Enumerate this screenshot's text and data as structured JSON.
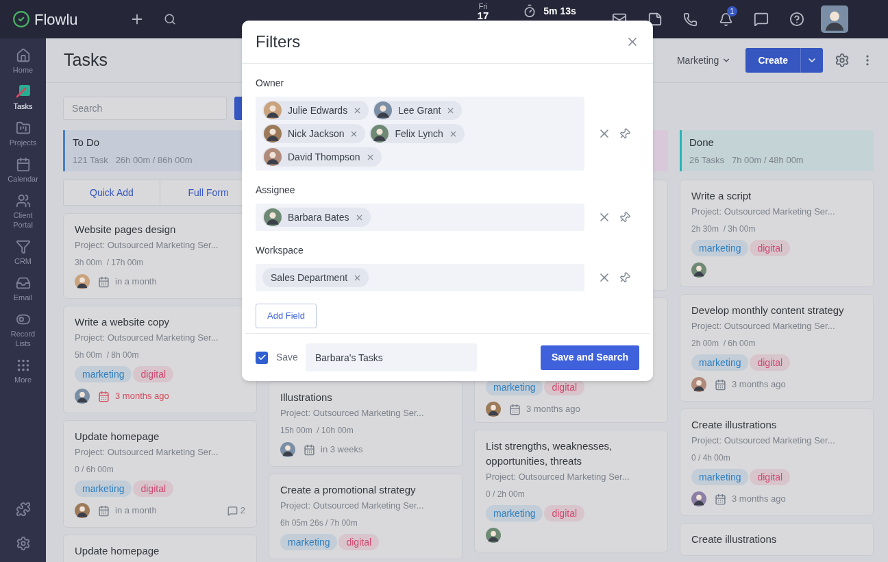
{
  "topbar": {
    "logo": "Flowlu",
    "day": "Fri",
    "date": "17",
    "timer": "5m 13s",
    "notifications": "1"
  },
  "sidebar": {
    "items": [
      {
        "label": "Home",
        "selected": false
      },
      {
        "label": "Tasks",
        "selected": true
      },
      {
        "label": "Projects",
        "selected": false
      },
      {
        "label": "Calendar",
        "selected": false
      },
      {
        "label": "Client Portal",
        "selected": false
      },
      {
        "label": "CRM",
        "selected": false
      },
      {
        "label": "Email",
        "selected": false
      },
      {
        "label": "Record Lists",
        "selected": false
      },
      {
        "label": "More",
        "selected": false
      }
    ]
  },
  "header": {
    "title": "Tasks",
    "workspace": "Marketing",
    "create": "Create"
  },
  "search": {
    "placeholder": "Search"
  },
  "columns": [
    {
      "title": "To Do",
      "count": "121 Task",
      "hours": "26h 00m / 86h 00m",
      "color": "#c5ccd8",
      "accent": {
        "color": "#4a7fc1"
      },
      "quick_add": "Quick Add",
      "full_form": "Full Form",
      "cards": [
        {
          "title": "Website pages design",
          "project": "Project: Outsourced Marketing Ser...",
          "time": "3h 00m  / 17h 00m",
          "avatar": true,
          "due": "in a month",
          "overdue": false
        },
        {
          "title": "Write a website copy",
          "project": "Project: Outsourced Marketing Ser...",
          "time": "5h 00m  / 8h 00m",
          "tags": [
            {
              "label": "marketing",
              "color": "#2f7fc0"
            },
            {
              "label": "digital",
              "color": "#d14770"
            }
          ],
          "avatar": true,
          "due": "3 months ago",
          "overdue": true
        },
        {
          "title": "Update homepage",
          "project": "Project: Outsourced Marketing Ser...",
          "time": "0 / 6h 00m",
          "tags": [
            {
              "label": "marketing",
              "color": "#2f7fc0"
            },
            {
              "label": "digital",
              "color": "#d14770"
            }
          ],
          "avatar": true,
          "due": "in a month",
          "overdue": false,
          "comments": "2"
        },
        {
          "title": "Update homepage"
        }
      ]
    },
    {
      "cards": [
        {
          "title": "Illustrations",
          "project": "Project: Outsourced Marketing Ser...",
          "time": "15h 00m  / 10h 00m",
          "avatar": true,
          "due": "in 3 weeks",
          "overdue": false
        },
        {
          "title": "Create a promotional strategy",
          "project": "Project: Outsourced Marketing Ser...",
          "time": "6h 05m 26s / 7h 00m",
          "tags": [
            {
              "label": "marketing",
              "color": "#2f7fc0"
            },
            {
              "label": "digital",
              "color": "#d14770"
            }
          ]
        }
      ]
    },
    {
      "color": "#d8c8da",
      "cards": [
        {
          "tags": [
            {
              "label": "marketing",
              "color": "#2f7fc0"
            },
            {
              "label": "digital",
              "color": "#d14770"
            }
          ],
          "avatar": true,
          "due": "3 months ago",
          "overdue": false
        },
        {
          "title": "List strengths, weaknesses, opportunities, threats",
          "project": "Project: Outsourced Marketing Ser...",
          "time": "0 / 2h 00m",
          "tags": [
            {
              "label": "marketing",
              "color": "#2f7fc0"
            },
            {
              "label": "digital",
              "color": "#d14770"
            }
          ],
          "avatar": true
        }
      ]
    },
    {
      "title": "Done",
      "count": "26 Tasks",
      "hours": "7h 00m / 48h 00m",
      "color": "#c3d3d6",
      "accent": {
        "color": "#26b5b8"
      },
      "cards": [
        {
          "title": "Write a script",
          "project": "Project: Outsourced Marketing Ser...",
          "time": "2h 30m  / 3h 00m",
          "tags": [
            {
              "label": "marketing",
              "color": "#2f7fc0"
            },
            {
              "label": "digital",
              "color": "#d14770"
            }
          ],
          "avatar": true
        },
        {
          "title": "Develop monthly content strategy",
          "project": "Project: Outsourced Marketing Ser...",
          "time": "2h 00m  / 6h 00m",
          "tags": [
            {
              "label": "marketing",
              "color": "#2f7fc0"
            },
            {
              "label": "digital",
              "color": "#d14770"
            }
          ],
          "avatar": true,
          "due": "3 months ago",
          "overdue": false
        },
        {
          "title": "Create illustrations",
          "project": "Project: Outsourced Marketing Ser...",
          "time": "0 / 4h 00m",
          "tags": [
            {
              "label": "marketing",
              "color": "#2f7fc0"
            },
            {
              "label": "digital",
              "color": "#d14770"
            }
          ],
          "avatar": true,
          "due": "3 months ago",
          "overdue": false
        },
        {
          "title": "Create illustrations"
        }
      ]
    }
  ],
  "filters": {
    "title": "Filters",
    "fields": [
      {
        "label": "Owner",
        "chips": [
          {
            "label": "Julie Edwards",
            "avatar": true
          },
          {
            "label": "Lee Grant",
            "avatar": true
          },
          {
            "label": "Nick Jackson",
            "avatar": true
          },
          {
            "label": "Felix Lynch",
            "avatar": true
          },
          {
            "label": "David Thompson",
            "avatar": true
          }
        ]
      },
      {
        "label": "Assignee",
        "chips": [
          {
            "label": "Barbara Bates",
            "avatar": true
          }
        ]
      },
      {
        "label": "Workspace",
        "chips": [
          {
            "label": "Sales Department",
            "avatar": false
          }
        ]
      }
    ],
    "add_field": "Add Field",
    "save_label": "Save",
    "save_checked": true,
    "save_name": "Barbara's Tasks",
    "submit": "Save and Search"
  }
}
